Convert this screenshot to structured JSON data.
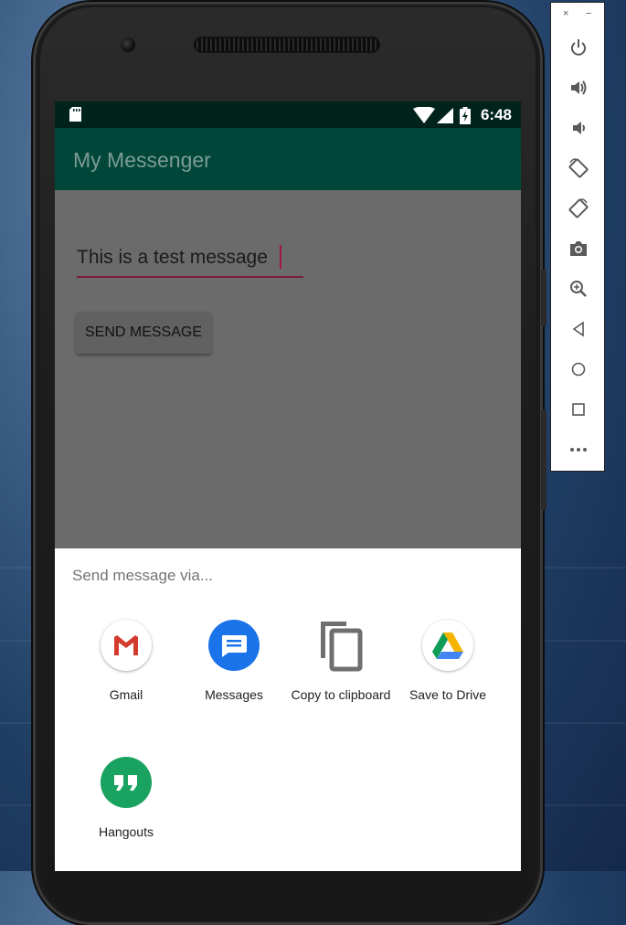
{
  "status_bar": {
    "time": "6:48"
  },
  "app_bar": {
    "title": "My Messenger"
  },
  "compose": {
    "message_value": "This is a test message",
    "send_button_label": "SEND MESSAGE"
  },
  "share_sheet": {
    "title": "Send message via...",
    "targets": [
      {
        "label": "Gmail",
        "icon": "gmail-icon"
      },
      {
        "label": "Messages",
        "icon": "messages-icon"
      },
      {
        "label": "Copy to clipboard",
        "icon": "copy-icon"
      },
      {
        "label": "Save to Drive",
        "icon": "drive-icon"
      },
      {
        "label": "Hangouts",
        "icon": "hangouts-icon"
      }
    ]
  },
  "emulator_toolbar": {
    "close_glyph": "×",
    "minimize_glyph": "−",
    "buttons": [
      "power-icon",
      "volume-up-icon",
      "volume-down-icon",
      "rotate-left-icon",
      "rotate-right-icon",
      "camera-icon",
      "zoom-icon",
      "back-icon",
      "home-icon",
      "overview-icon",
      "more-icon"
    ]
  },
  "colors": {
    "app_bar": "#00473a",
    "status_bar": "#00231b",
    "accent": "#7a1c40",
    "scrim": "#6b6b6b"
  }
}
